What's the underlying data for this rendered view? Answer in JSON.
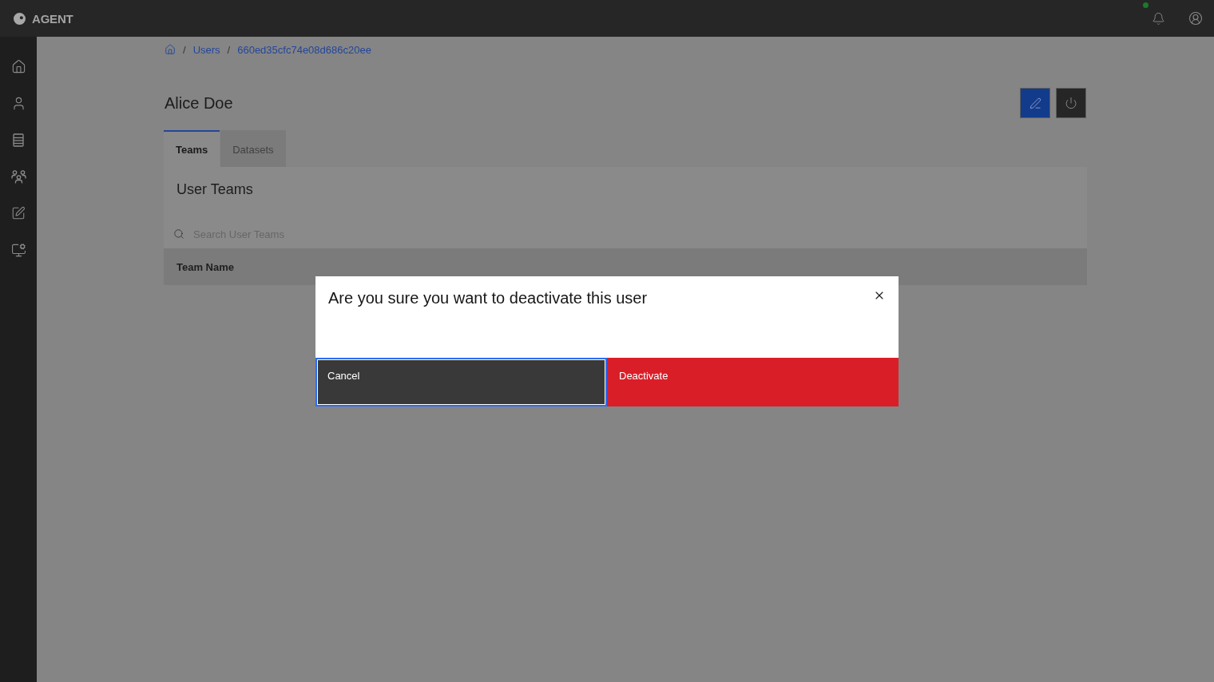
{
  "header": {
    "brand": "AGENT",
    "unread_notifications": true
  },
  "sidebar": {
    "items": [
      {
        "kind": "home"
      },
      {
        "kind": "user"
      },
      {
        "kind": "list"
      },
      {
        "kind": "team"
      },
      {
        "kind": "edit"
      },
      {
        "kind": "monitor"
      }
    ]
  },
  "breadcrumb": [
    {
      "kind": "home",
      "separator": "/"
    },
    {
      "kind": "link",
      "label": "Users",
      "separator": "/"
    },
    {
      "kind": "link",
      "label": "660ed35cfc74e08d686c20ee"
    }
  ],
  "page": {
    "title": "Alice Doe",
    "actions": [
      {
        "kind": "edit"
      },
      {
        "kind": "power"
      }
    ]
  },
  "tabs": [
    {
      "label": "Teams",
      "selected": true
    },
    {
      "label": "Datasets",
      "selected": false
    }
  ],
  "panel": {
    "title": "User Teams",
    "search": {
      "placeholder": "Search User Teams"
    },
    "table": {
      "columns": [
        "Team Name"
      ]
    }
  },
  "modal": {
    "title": "Are you sure you want to deactivate this user",
    "buttons": [
      {
        "label": "Cancel",
        "kind": "secondary",
        "focused": true
      },
      {
        "label": "Deactivate",
        "kind": "danger",
        "focused": false
      }
    ]
  }
}
